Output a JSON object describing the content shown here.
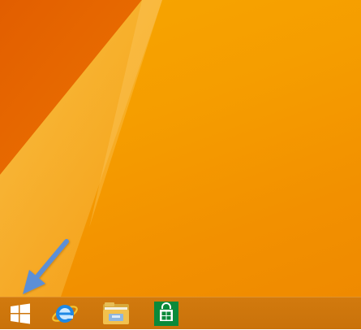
{
  "screen": {
    "desktop": {
      "wallpaper": {
        "colors": {
          "base": "#f59d00",
          "dark_wedge": "#e86a00",
          "light_ray": "#f8b33a"
        }
      }
    },
    "taskbar": {
      "background": "#cc750c",
      "start_button": {
        "icon": "windows-logo-icon",
        "color": "#ffffff"
      },
      "pinned_apps": [
        {
          "id": "internet-explorer",
          "icon": "internet-explorer-icon",
          "color": "#1e88e5"
        },
        {
          "id": "file-explorer",
          "icon": "file-explorer-folder-icon",
          "color": "#f2c14e"
        },
        {
          "id": "store",
          "icon": "store-bag-icon",
          "color": "#0a8a3a"
        }
      ]
    },
    "annotation": {
      "arrow_color": "#5b8fd6",
      "points_to": "start_button"
    }
  }
}
